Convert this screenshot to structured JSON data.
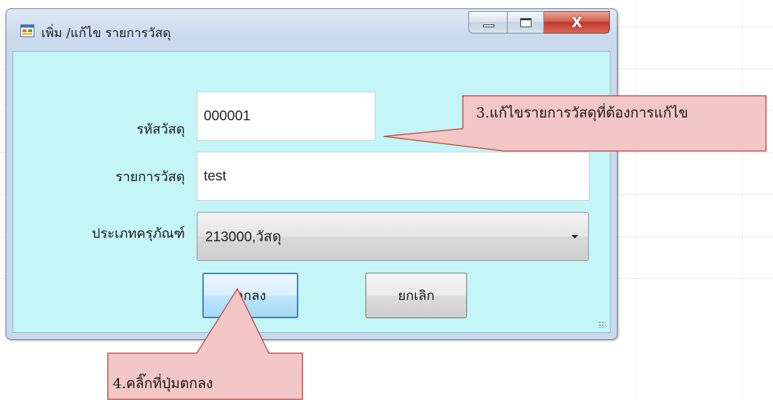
{
  "window": {
    "title": "เพิ่ม /แก้ไข รายการวัสดุ",
    "minimize_icon": "minimize-icon",
    "maximize_icon": "maximize-icon",
    "close_label": "X"
  },
  "form": {
    "code_label": "รหัสวัสดุ",
    "code_value": "000001",
    "name_label": "รายการวัสดุ",
    "name_value": "test",
    "type_label": "ประเภทครุภัณฑ์",
    "type_value": "213000,วัสดุ",
    "ok_label": "ตกลง",
    "cancel_label": "ยกเลิก"
  },
  "callouts": {
    "step3": "3.แก้ไขรายการวัสดุที่ต้องการแก้ไข",
    "step4": "4.คลิ๊กที่ปุ่มตกลง"
  },
  "colors": {
    "client_background": "#c4f5f7",
    "callout_fill": "#f2c7c5",
    "callout_border": "#c0504d",
    "close_button": "#c0382a"
  }
}
